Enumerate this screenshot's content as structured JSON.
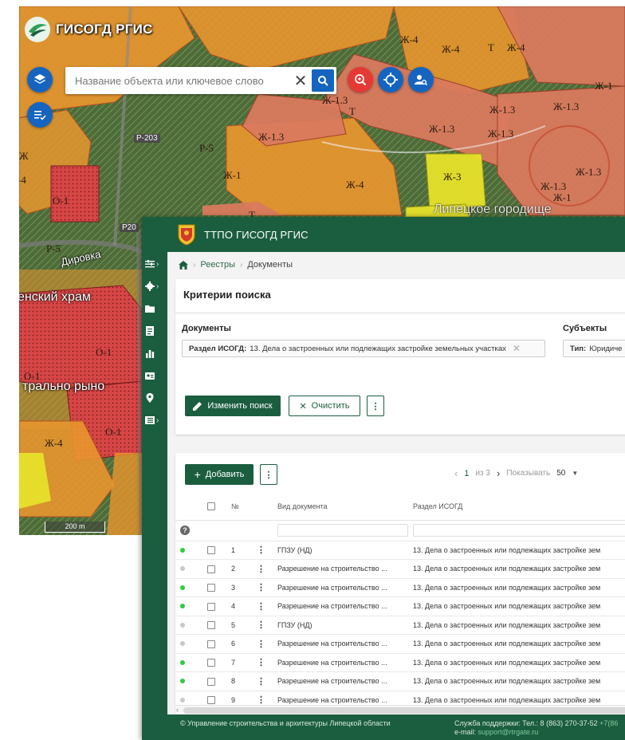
{
  "map": {
    "brand_title": "ГИСОГД РГИС",
    "search": {
      "placeholder": "Название объекта или ключевое слово",
      "clear_icon": "close-icon",
      "search_icon": "search-icon"
    },
    "scale_label": "200 m",
    "zone_labels": [
      "Ж-4",
      "Ж-4",
      "Ж-4",
      "Т",
      "Ж-1.3",
      "Т",
      "Ж-1.3",
      "Ж-1.3",
      "Ж-1.3",
      "Ж-1.3",
      "Ж-1",
      "Ж-3",
      "Ж-1.3",
      "Ж-1.3",
      "Ж-1.3",
      "Ж-1",
      "Р-5",
      "Ж-1",
      "Ж-4",
      "О-1",
      "Р-5",
      "О-1",
      "О-1",
      "О-1",
      "Ж-4",
      "Ж-4",
      "Ж",
      "-4",
      "Т",
      "Р-203",
      "Р20"
    ],
    "place_labels": [
      "енский храм",
      "Дировка",
      "трально рыно",
      "Липецкое городище"
    ],
    "buttons": [
      "layers-icon",
      "list-check-icon",
      "location-search-icon",
      "crosshair-icon",
      "user-search-icon"
    ]
  },
  "app": {
    "header_title": "ТТПО ГИСОГД РГИС",
    "breadcrumbs": [
      "Реестры",
      "Документы"
    ],
    "criteria": {
      "title": "Критерии поиска",
      "documents_group": "Документы",
      "documents_chip_key": "Раздел ИСОГД:",
      "documents_chip_value": "13. Дела о застроенных или подлежащих застройке земельных участках",
      "subjects_group": "Субъекты",
      "subjects_chip_key": "Тип:",
      "subjects_chip_value": "Юридиче",
      "edit_button": "Изменить поиск",
      "clear_button": "Очистить"
    },
    "grid": {
      "add_button": "Добавить",
      "pager": {
        "page": "1",
        "of": "из 3",
        "show_label": "Показывать",
        "page_size": "50"
      },
      "columns": [
        "№",
        "Вид документа",
        "Раздел ИСОГД"
      ],
      "rows": [
        {
          "no": "1",
          "status": "active",
          "type": "ГПЗУ (НД)",
          "section": "13. Дела о застроенных или подлежащих застройке зем"
        },
        {
          "no": "2",
          "status": "inactive",
          "type": "Разрешение на строительство ...",
          "section": "13. Дела о застроенных или подлежащих застройке зем"
        },
        {
          "no": "3",
          "status": "active",
          "type": "Разрешение на строительство ...",
          "section": "13. Дела о застроенных или подлежащих застройке зем"
        },
        {
          "no": "4",
          "status": "active",
          "type": "Разрешение на строительство ...",
          "section": "13. Дела о застроенных или подлежащих застройке зем"
        },
        {
          "no": "5",
          "status": "inactive",
          "type": "ГПЗУ (НД)",
          "section": "13. Дела о застроенных или подлежащих застройке зем"
        },
        {
          "no": "6",
          "status": "inactive",
          "type": "Разрешение на строительство ...",
          "section": "13. Дела о застроенных или подлежащих застройке зем"
        },
        {
          "no": "7",
          "status": "active",
          "type": "Разрешение на строительство ...",
          "section": "13. Дела о застроенных или подлежащих застройке зем"
        },
        {
          "no": "8",
          "status": "active",
          "type": "Разрешение на строительство ...",
          "section": "13. Дела о застроенных или подлежащих застройке зем"
        },
        {
          "no": "9",
          "status": "inactive",
          "type": "Разрешение на строительство ...",
          "section": "13. Дела о застроенных или подлежащих застройке зем"
        }
      ]
    },
    "footer": {
      "copyright": "© Управление строительства и архитектуры Липецкой области",
      "support_label": "Служба поддержки: Тел.: 8 (863) 270-37-52",
      "support_extra": "+7(86",
      "email_label": "e-mail:",
      "email": "support@rtrgate.ru"
    },
    "side_icons": [
      "sliders-icon",
      "gear-icon",
      "folder-icon",
      "registry-icon",
      "chart-icon",
      "id-card-icon",
      "map-marker-icon",
      "list-icon"
    ]
  },
  "colors": {
    "brand_green": "#1b5e3f",
    "map_blue": "#1565c0",
    "map_red": "#e53935",
    "status_active": "#2ecc40",
    "status_inactive": "#c8c8c8",
    "zone_orange": "#e8962e",
    "zone_salmon": "#d97a5e",
    "zone_red": "#d64a4a",
    "zone_yellow": "#e6e22a"
  }
}
